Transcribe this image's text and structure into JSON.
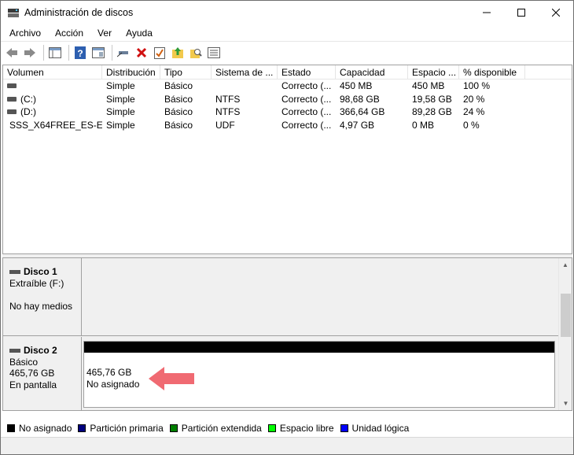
{
  "window": {
    "title": "Administración de discos"
  },
  "menu": {
    "items": [
      "Archivo",
      "Acción",
      "Ver",
      "Ayuda"
    ]
  },
  "volume_table": {
    "columns": [
      "Volumen",
      "Distribución",
      "Tipo",
      "Sistema de ...",
      "Estado",
      "Capacidad",
      "Espacio ...",
      "% disponible"
    ],
    "rows": [
      {
        "volume": "",
        "layout": "Simple",
        "type": "Básico",
        "fs": "",
        "status": "Correcto (...",
        "capacity": "450 MB",
        "free": "450 MB",
        "pct": "100 %"
      },
      {
        "volume": "(C:)",
        "layout": "Simple",
        "type": "Básico",
        "fs": "NTFS",
        "status": "Correcto (...",
        "capacity": "98,68 GB",
        "free": "19,58 GB",
        "pct": "20 %"
      },
      {
        "volume": "(D:)",
        "layout": "Simple",
        "type": "Básico",
        "fs": "NTFS",
        "status": "Correcto (...",
        "capacity": "366,64 GB",
        "free": "89,28 GB",
        "pct": "24 %"
      },
      {
        "volume": "SSS_X64FREE_ES-E...",
        "layout": "Simple",
        "type": "Básico",
        "fs": "UDF",
        "status": "Correcto (...",
        "capacity": "4,97 GB",
        "free": "0 MB",
        "pct": "0 %"
      }
    ]
  },
  "disks": [
    {
      "name": "Disco 1",
      "line1": "Extraíble (F:)",
      "line2": "",
      "line3": "No hay medios"
    },
    {
      "name": "Disco 2",
      "line1": "Básico",
      "line2": "465,76 GB",
      "line3": "En pantalla",
      "partition": {
        "size": "465,76 GB",
        "status": "No asignado"
      }
    }
  ],
  "legend": [
    {
      "label": "No asignado",
      "color": "#000000"
    },
    {
      "label": "Partición primaria",
      "color": "#00007f"
    },
    {
      "label": "Partición extendida",
      "color": "#007f00"
    },
    {
      "label": "Espacio libre",
      "color": "#00ff00"
    },
    {
      "label": "Unidad lógica",
      "color": "#0000ff"
    }
  ],
  "colors": {
    "unallocated_header": "#000000",
    "arrow": "#f06a72"
  },
  "icons": {
    "toolbar": [
      "back-arrow-icon",
      "forward-arrow-icon",
      "console-tree-icon",
      "help-icon",
      "properties-icon",
      "connect-icon",
      "delete-icon",
      "check-icon",
      "folder-up-icon",
      "search-folder-icon",
      "list-view-icon"
    ]
  }
}
